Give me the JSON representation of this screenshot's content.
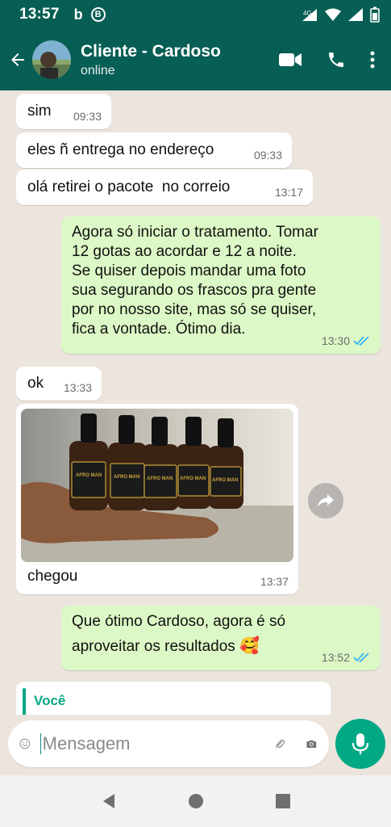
{
  "status_bar": {
    "time": "13:57",
    "left_icons": [
      "b-icon",
      "b-circle-icon"
    ],
    "b_label": "b",
    "b_circle_label": "B",
    "network": "4G"
  },
  "header": {
    "contact_name": "Cliente - Cardoso",
    "presence": "online"
  },
  "messages": [
    {
      "dir": "in",
      "text": "sim",
      "time": "09:33"
    },
    {
      "dir": "in",
      "text": "eles ñ entrega no endereço",
      "time": "09:33"
    },
    {
      "dir": "in",
      "text": "olá retirei o pacote  no correio",
      "time": "13:17"
    },
    {
      "dir": "out",
      "text_lines": [
        "Agora só iniciar o tratamento. Tomar",
        "12 gotas ao acordar e 12 a noite.",
        "Se quiser depois mandar uma foto",
        "sua segurando os frascos pra gente",
        "por no nosso site, mas só se quiser,",
        "fica a vontade. Ótimo dia."
      ],
      "time": "13:30",
      "read": true
    },
    {
      "dir": "in",
      "text": "ok",
      "time": "13:33"
    },
    {
      "dir": "in",
      "type": "image",
      "caption": "chegou",
      "time": "13:37",
      "bottle_label": "AFRO MAN"
    },
    {
      "dir": "out",
      "text_lines": [
        "Que ótimo Cardoso, agora é só",
        "aproveitar os resultados"
      ],
      "emoji": "🥰",
      "time": "13:52",
      "read": true
    }
  ],
  "quote": {
    "title": "Você"
  },
  "composer": {
    "placeholder": "Mensagem"
  },
  "colors": {
    "header": "#075e54",
    "outgoing": "#dcf8c6",
    "incoming": "#ffffff",
    "accent": "#00a884",
    "read_ticks": "#34b7f1"
  }
}
